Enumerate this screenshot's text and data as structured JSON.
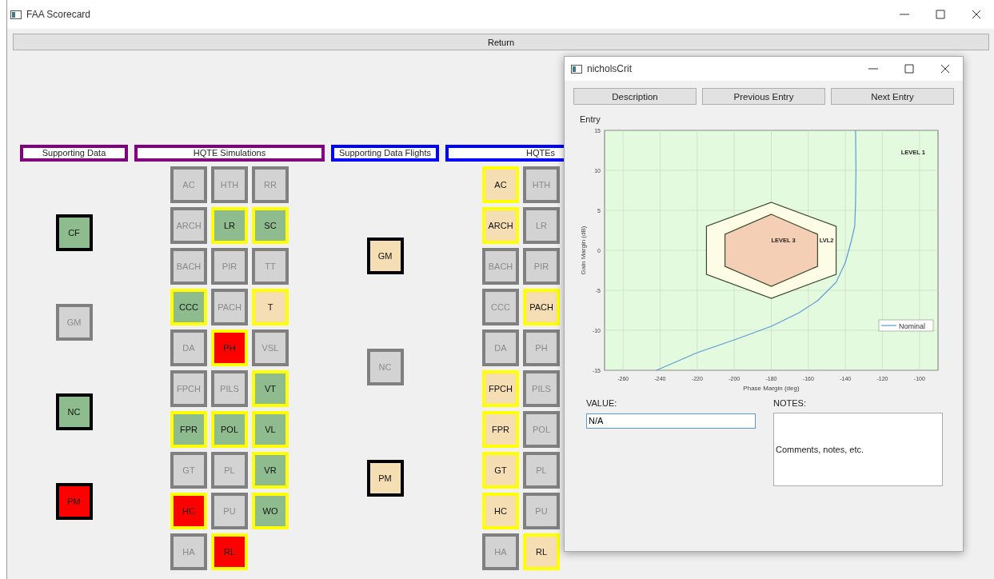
{
  "window": {
    "title": "FAA Scorecard"
  },
  "return_button": "Return",
  "groups": [
    {
      "title": "Supporting Data",
      "kind": "supporting",
      "tiles": [
        {
          "label": "CF",
          "color": "#8fbc8f",
          "active": true
        },
        {
          "label": "GM",
          "color": "#d3d3d3",
          "active": false
        },
        {
          "label": "NC",
          "color": "#8fbc8f",
          "active": true
        },
        {
          "label": "PM",
          "color": "#ff0000",
          "active": true
        }
      ]
    },
    {
      "title": "HQTE Simulations",
      "kind": "hqte",
      "tiles": [
        {
          "label": "AC",
          "color": "#d3d3d3",
          "active": false
        },
        {
          "label": "HTH",
          "color": "#d3d3d3",
          "active": false
        },
        {
          "label": "RR",
          "color": "#d3d3d3",
          "active": false
        },
        {
          "label": "ARCH",
          "color": "#d3d3d3",
          "active": false
        },
        {
          "label": "LR",
          "color": "#8fbc8f",
          "active": true
        },
        {
          "label": "SC",
          "color": "#8fbc8f",
          "active": true
        },
        {
          "label": "BACH",
          "color": "#d3d3d3",
          "active": false
        },
        {
          "label": "PIR",
          "color": "#d3d3d3",
          "active": false
        },
        {
          "label": "TT",
          "color": "#d3d3d3",
          "active": false
        },
        {
          "label": "CCC",
          "color": "#8fbc8f",
          "active": true
        },
        {
          "label": "PACH",
          "color": "#d3d3d3",
          "active": false
        },
        {
          "label": "T",
          "color": "#f5deb3",
          "active": true
        },
        {
          "label": "DA",
          "color": "#d3d3d3",
          "active": false
        },
        {
          "label": "PH",
          "color": "#ff0000",
          "active": true
        },
        {
          "label": "VSL",
          "color": "#d3d3d3",
          "active": false
        },
        {
          "label": "FPCH",
          "color": "#d3d3d3",
          "active": false
        },
        {
          "label": "PILS",
          "color": "#d3d3d3",
          "active": false
        },
        {
          "label": "VT",
          "color": "#8fbc8f",
          "active": true
        },
        {
          "label": "FPR",
          "color": "#8fbc8f",
          "active": true
        },
        {
          "label": "POL",
          "color": "#8fbc8f",
          "active": true
        },
        {
          "label": "VL",
          "color": "#8fbc8f",
          "active": true
        },
        {
          "label": "GT",
          "color": "#d3d3d3",
          "active": false
        },
        {
          "label": "PL",
          "color": "#d3d3d3",
          "active": false
        },
        {
          "label": "VR",
          "color": "#8fbc8f",
          "active": true
        },
        {
          "label": "HC",
          "color": "#ff0000",
          "active": true
        },
        {
          "label": "PU",
          "color": "#d3d3d3",
          "active": false
        },
        {
          "label": "WO",
          "color": "#8fbc8f",
          "active": true
        },
        {
          "label": "HA",
          "color": "#d3d3d3",
          "active": false
        },
        {
          "label": "RL",
          "color": "#ff0000",
          "active": true
        }
      ]
    },
    {
      "title": "Supporting Data Flights",
      "kind": "supporting",
      "tiles": [
        {
          "label": "GM",
          "color": "#f5deb3",
          "active": true
        },
        {
          "label": "NC",
          "color": "#d3d3d3",
          "active": false
        },
        {
          "label": "PM",
          "color": "#f5deb3",
          "active": true
        }
      ]
    },
    {
      "title": "HQTEs",
      "kind": "hqte",
      "tiles": [
        {
          "label": "AC",
          "color": "#f5deb3",
          "active": true
        },
        {
          "label": "HTH",
          "color": "#d3d3d3",
          "active": false
        },
        {
          "label": "ARCH",
          "color": "#f5deb3",
          "active": true
        },
        {
          "label": "LR",
          "color": "#d3d3d3",
          "active": false
        },
        {
          "label": "BACH",
          "color": "#d3d3d3",
          "active": false
        },
        {
          "label": "PIR",
          "color": "#d3d3d3",
          "active": false
        },
        {
          "label": "CCC",
          "color": "#d3d3d3",
          "active": false
        },
        {
          "label": "PACH",
          "color": "#f5deb3",
          "active": true
        },
        {
          "label": "DA",
          "color": "#d3d3d3",
          "active": false
        },
        {
          "label": "PH",
          "color": "#d3d3d3",
          "active": false
        },
        {
          "label": "FPCH",
          "color": "#f5deb3",
          "active": true
        },
        {
          "label": "PILS",
          "color": "#d3d3d3",
          "active": false
        },
        {
          "label": "FPR",
          "color": "#f5deb3",
          "active": true
        },
        {
          "label": "POL",
          "color": "#d3d3d3",
          "active": false
        },
        {
          "label": "GT",
          "color": "#f5deb3",
          "active": true
        },
        {
          "label": "PL",
          "color": "#d3d3d3",
          "active": false
        },
        {
          "label": "HC",
          "color": "#f5deb3",
          "active": true
        },
        {
          "label": "PU",
          "color": "#d3d3d3",
          "active": false
        },
        {
          "label": "HA",
          "color": "#d3d3d3",
          "active": false
        },
        {
          "label": "RL",
          "color": "#f5deb3",
          "active": true
        }
      ]
    }
  ],
  "dialog": {
    "title": "nicholsCrit",
    "buttons": [
      "Description",
      "Previous Entry",
      "Next Entry"
    ],
    "entry_label": "Entry",
    "chart_data": {
      "type": "line",
      "xlabel": "Phase Margin (deg)",
      "ylabel": "Gain Margin (dB)",
      "x": [
        -242,
        -220,
        -200,
        -180,
        -165,
        -155,
        -145,
        -140,
        -137,
        -135,
        -134.5,
        -134.3,
        -134.5
      ],
      "series": [
        {
          "name": "Nominal",
          "color": "#5b9bd5",
          "values": [
            -15,
            -12.8,
            -11.2,
            -9.5,
            -7.8,
            -6.3,
            -4,
            -1.5,
            1,
            3,
            6,
            10,
            15
          ]
        }
      ],
      "xlim": [
        -270,
        -90
      ],
      "ylim": [
        -15,
        15
      ],
      "xticks": [
        -260,
        -240,
        -220,
        -200,
        -180,
        -160,
        -140,
        -120,
        -100
      ],
      "yticks": [
        -15,
        -10,
        -5,
        0,
        5,
        10,
        15
      ],
      "grid": true,
      "annotations": [
        "LEVEL 1",
        "LEVEL 3",
        "LVL2"
      ]
    },
    "value_field": {
      "label": "VALUE:",
      "value": "N/A"
    },
    "notes_field": {
      "label": "NOTES:",
      "value": "Comments, notes, etc."
    }
  }
}
